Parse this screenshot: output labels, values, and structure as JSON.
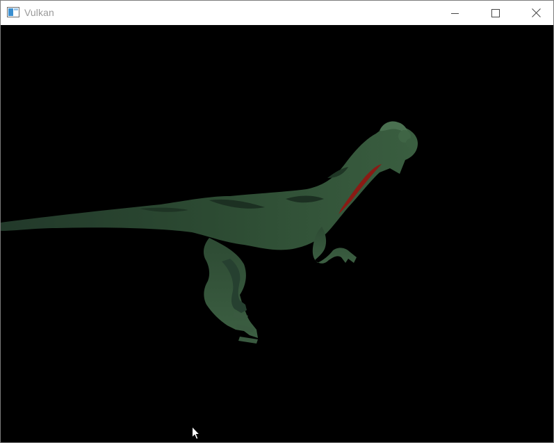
{
  "window": {
    "title": "Vulkan",
    "app_icon": "window-app-icon",
    "controls": [
      "minimize-icon",
      "maximize-icon",
      "close-icon"
    ]
  },
  "viewport": {
    "background_color": "#000000",
    "model_color": "#2e4a30",
    "model_accent_color": "#8a1a14",
    "subject": "dinosaur-model"
  },
  "cursor": {
    "icon": "arrow-cursor-icon"
  }
}
